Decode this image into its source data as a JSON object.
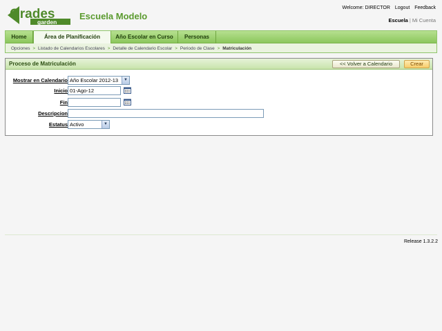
{
  "header": {
    "logo_top": "Grades",
    "logo_bottom": "garden",
    "school_name": "Escuela Modelo",
    "welcome": "Welcome: DIRECTOR",
    "logout": "Logout",
    "feedback": "Feedback",
    "context_active": "Escuela",
    "context_other": "Mi Cuenta"
  },
  "nav": {
    "tabs": [
      {
        "label": "Home"
      },
      {
        "label": "Área de Planificación"
      },
      {
        "label": "Año Escolar en Curso"
      },
      {
        "label": "Personas"
      }
    ],
    "breadcrumb": [
      "Opciones",
      "Listado de Calendarios Escolares",
      "Detalle de Calendario Escolar",
      "Periodo de Clase",
      "Matriculación"
    ]
  },
  "panel": {
    "title": "Proceso de Matriculación",
    "back_button": "<< Volver a Calendario",
    "create_button": "Crear"
  },
  "form": {
    "show_in_calendar_label": "Mostrar en Calendario",
    "show_in_calendar_value": "Año Escolar 2012-13",
    "start_label": "Inicio",
    "start_value": "01-Ago-12",
    "end_label": "Fin",
    "end_value": "",
    "description_label": "Descripcion",
    "description_value": "",
    "status_label": "Estatus",
    "status_value": "Activo"
  },
  "footer": {
    "release": "Release 1.3.2.2"
  },
  "colors": {
    "brand_green": "#5a9a2e",
    "tab_bar": "#8cc75c",
    "create_button": "#f7cc6a"
  }
}
